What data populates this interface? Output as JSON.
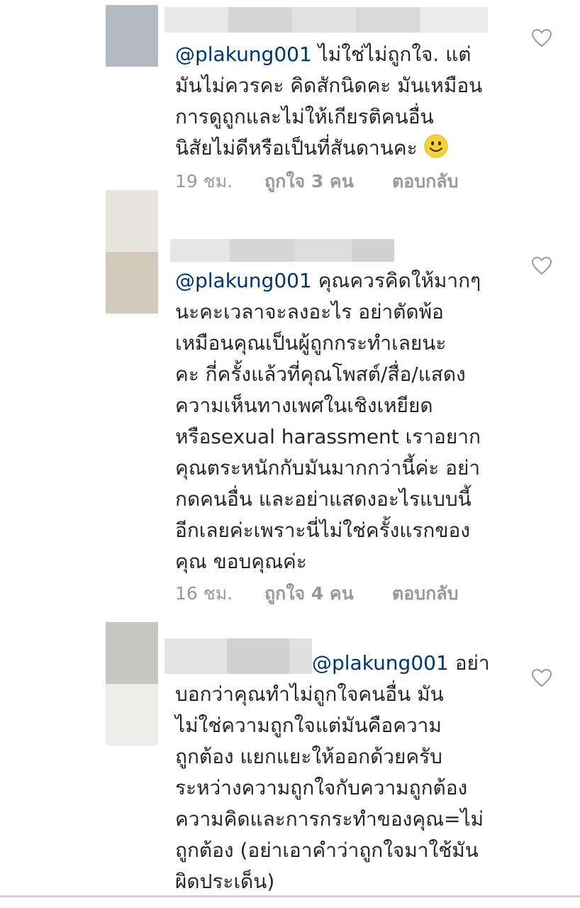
{
  "comments": [
    {
      "mention": "@plakung001",
      "lines": [
        "ไม่ใช่ไม่ถูกใจ. แต่",
        "มันไม่ควรคะ คิดสักนิดคะ มันเหมือน",
        "การดูถูกและไม่ให้เกียรติคนอื่น",
        "นิสัยไม่ดีหรือเป็นที่สันดานคะ"
      ],
      "emoji": "smile-emoji",
      "time": "19 ชม.",
      "likes": "ถูกใจ 3 คน",
      "reply": "ตอบกลับ"
    },
    {
      "mention": "@plakung001",
      "lines": [
        "คุณควรคิดให้มากๆ",
        "นะคะเวลาจะลงอะไร อย่าตัดพ้อ",
        "เหมือนคุณเป็นผู้ถูกกระทำเลยนะ",
        "คะ กี่ครั้งแล้วที่คุณโพสต์/สื่อ/แสดง",
        "ความเห็นทางเพศในเชิงเหยียด",
        "หรือsexual harassment เราอยาก",
        "คุณตระหนักกับมันมากกว่านี้ค่ะ อย่า",
        "กดคนอื่น และอย่าแสดงอะไรแบบนี้",
        "อีกเลยค่ะเพราะนี่ไม่ใช่ครั้งแรกของ",
        "คุณ ขอบคุณค่ะ"
      ],
      "time": "16 ชม.",
      "likes": "ถูกใจ 4 คน",
      "reply": "ตอบกลับ"
    },
    {
      "mention": "@plakung001",
      "lines": [
        "อย่า",
        "บอกว่าคุณทำไม่ถูกใจคนอื่น มัน",
        "ไม่ใช่ความถูกใจแต่มันคือความ",
        "ถูกต้อง แยกแยะให้ออกด้วยครับ",
        "ระหว่างความถูกใจกับความถูกต้อง",
        "ความคิดและการกระทำของคุณ=ไม่",
        "ถูกต้อง (อย่าเอาคำว่าถูกใจมาใช้มัน",
        "ผิดประเด็น)"
      ]
    }
  ],
  "colors": {
    "text": "#262626",
    "mention": "#003569",
    "meta": "#999999",
    "heart": "#999999"
  }
}
